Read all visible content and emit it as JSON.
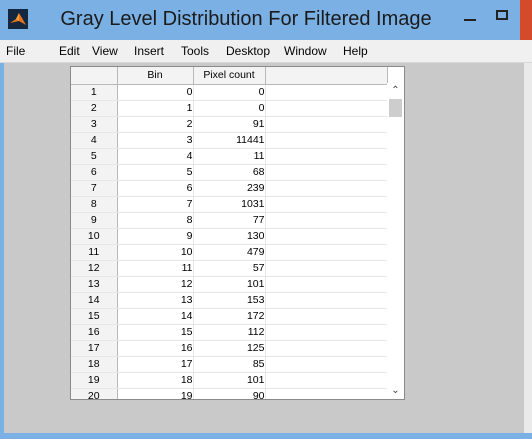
{
  "window": {
    "title": "Gray Level Distribution For Filtered Image",
    "icon": "matlab-logo-icon",
    "colors": {
      "titlebar": "#7ab0e4",
      "close": "#d44a2a",
      "client": "#c9c9c9"
    }
  },
  "menubar": {
    "items": [
      "File",
      "Edit",
      "View",
      "Insert",
      "Tools",
      "Desktop",
      "Window",
      "Help"
    ]
  },
  "table": {
    "columns": [
      "Bin",
      "Pixel count"
    ],
    "rows": [
      {
        "row": "1",
        "bin": "0",
        "count": "0"
      },
      {
        "row": "2",
        "bin": "1",
        "count": "0"
      },
      {
        "row": "3",
        "bin": "2",
        "count": "91"
      },
      {
        "row": "4",
        "bin": "3",
        "count": "11441"
      },
      {
        "row": "5",
        "bin": "4",
        "count": "11"
      },
      {
        "row": "6",
        "bin": "5",
        "count": "68"
      },
      {
        "row": "7",
        "bin": "6",
        "count": "239"
      },
      {
        "row": "8",
        "bin": "7",
        "count": "1031"
      },
      {
        "row": "9",
        "bin": "8",
        "count": "77"
      },
      {
        "row": "10",
        "bin": "9",
        "count": "130"
      },
      {
        "row": "11",
        "bin": "10",
        "count": "479"
      },
      {
        "row": "12",
        "bin": "11",
        "count": "57"
      },
      {
        "row": "13",
        "bin": "12",
        "count": "101"
      },
      {
        "row": "14",
        "bin": "13",
        "count": "153"
      },
      {
        "row": "15",
        "bin": "14",
        "count": "172"
      },
      {
        "row": "16",
        "bin": "15",
        "count": "112"
      },
      {
        "row": "17",
        "bin": "16",
        "count": "125"
      },
      {
        "row": "18",
        "bin": "17",
        "count": "85"
      },
      {
        "row": "19",
        "bin": "18",
        "count": "101"
      },
      {
        "row": "20",
        "bin": "19",
        "count": "90"
      }
    ]
  },
  "scrollbar": {
    "up_icon": "chevron-up-icon",
    "down_icon": "chevron-down-icon"
  }
}
